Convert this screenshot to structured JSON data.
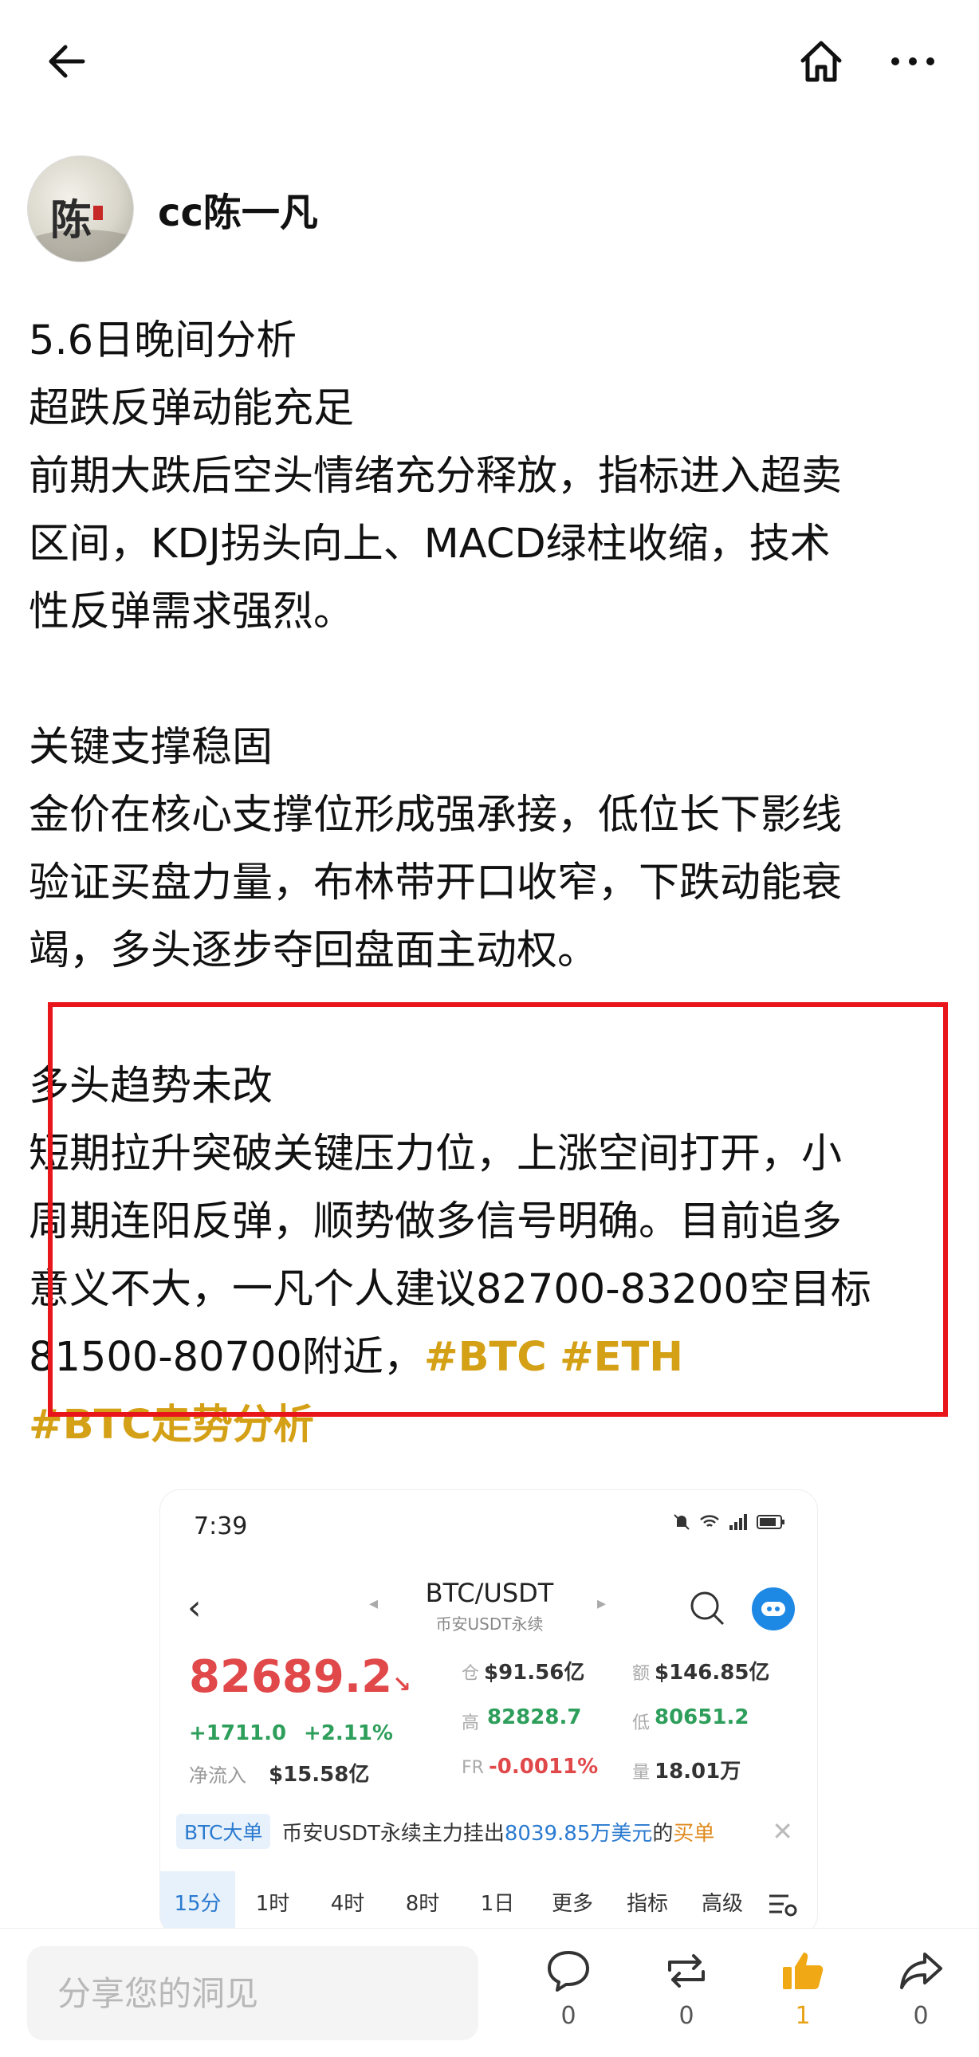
{
  "post": {
    "author": "cc陈一凡",
    "avatar_text": "陈",
    "paragraphs": [
      {
        "lines": [
          "5.6日晚间分析",
          "超跌反弹动能充足",
          "前期大跌后空头情绪充分释放，指标进入超卖",
          "区间，KDJ拐头向上、MACD绿柱收缩，技术",
          "性反弹需求强烈。"
        ]
      },
      {
        "lines": [
          "关键支撑稳固",
          "金价在核心支撑位形成强承接，低位长下影线",
          "验证买盘力量，布林带开口收窄，下跌动能衰",
          "竭，多头逐步夺回盘面主动权。"
        ]
      },
      {
        "lines": [
          "多头趋势未改",
          "短期拉升突破关键压力位，上涨空间打开，小",
          "周期连阳反弹，顺势做多信号明确。目前追多",
          "意义不大，一凡个人建议82700-83200空目标"
        ]
      }
    ],
    "last_line_text": "81500-80700附近，",
    "tags": [
      "#BTC",
      "#ETH",
      "#BTC走势分析"
    ]
  },
  "embedded": {
    "time": "7:39",
    "pair": "BTC/USDT",
    "pair_sub": "币安USDT永续",
    "price": "82689.2",
    "price_arrow": "↘",
    "change_abs": "+1711.0",
    "change_pct": "+2.11%",
    "inflow_label": "净流入",
    "inflow_value": "$15.58亿",
    "stats": {
      "oi_label": "仓",
      "oi_value": "$91.56亿",
      "amount_label": "额",
      "amount_value": "$146.85亿",
      "high_label": "高",
      "high_value": "82828.7",
      "low_label": "低",
      "low_value": "80651.2",
      "fr_label": "FR",
      "fr_value": "-0.0011%",
      "vol_label": "量",
      "vol_value": "18.01万"
    },
    "banner": {
      "badge": "BTC大单",
      "text_pre": "币安USDT永续主力挂出",
      "amount": "8039.85万美元",
      "text_mid": "的",
      "side": "买单",
      "close": "✕"
    },
    "tabs": [
      "15分",
      "1时",
      "4时",
      "8时",
      "1日",
      "更多",
      "指标",
      "高级"
    ]
  },
  "bottom": {
    "comment_placeholder": "分享您的洞见",
    "comments_count": "0",
    "reposts_count": "0",
    "likes_count": "1",
    "shares_count": "0"
  },
  "colors": {
    "tag": "#d4a016",
    "highlight_box": "#e8161b",
    "price_red": "#e0484a",
    "gain_green": "#2e9e5b",
    "like_active": "#e8a317"
  }
}
